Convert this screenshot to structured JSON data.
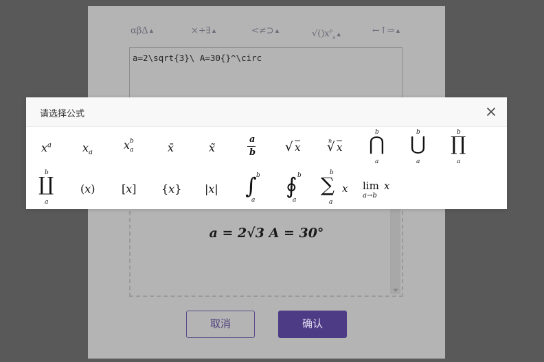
{
  "toolbar": {
    "groups": [
      {
        "label": "αβΔ"
      },
      {
        "label": "×÷∃"
      },
      {
        "label": "<≠⊃"
      },
      {
        "label": "√()x"
      },
      {
        "label": "←↑⇒"
      }
    ]
  },
  "editor": {
    "latex_value": "a=2\\sqrt{3}\\ A=30{}^\\circ",
    "preview_text": "a = 2√3 A = 30°"
  },
  "buttons": {
    "cancel": "取消",
    "confirm": "确认"
  },
  "modal": {
    "title": "请选择公式",
    "row1": [
      "x^a",
      "x_a",
      "x_a^b",
      "x̄",
      "x̃",
      "a/b",
      "√x",
      "ⁿ√x",
      "∩ a..b",
      "∪ a..b",
      "∏ a..b"
    ],
    "row2": [
      "∐ a..b",
      "(x)",
      "[x]",
      "{x}",
      "|x|",
      "∫ a..b",
      "∮ a..b",
      "∑ a..b x",
      "lim a→b x"
    ]
  },
  "colors": {
    "overlay": "#595959",
    "panel": "#b4b4b4",
    "primary": "#4e3b86",
    "modal_header": "#f8f8f8"
  }
}
